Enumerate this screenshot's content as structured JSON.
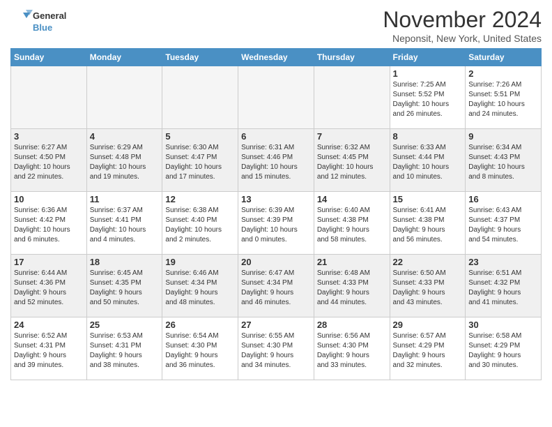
{
  "logo": {
    "line1": "General",
    "line2": "Blue"
  },
  "title": "November 2024",
  "location": "Neponsit, New York, United States",
  "days_of_week": [
    "Sunday",
    "Monday",
    "Tuesday",
    "Wednesday",
    "Thursday",
    "Friday",
    "Saturday"
  ],
  "weeks": [
    [
      {
        "day": "",
        "info": ""
      },
      {
        "day": "",
        "info": ""
      },
      {
        "day": "",
        "info": ""
      },
      {
        "day": "",
        "info": ""
      },
      {
        "day": "",
        "info": ""
      },
      {
        "day": "1",
        "info": "Sunrise: 7:25 AM\nSunset: 5:52 PM\nDaylight: 10 hours\nand 26 minutes."
      },
      {
        "day": "2",
        "info": "Sunrise: 7:26 AM\nSunset: 5:51 PM\nDaylight: 10 hours\nand 24 minutes."
      }
    ],
    [
      {
        "day": "3",
        "info": "Sunrise: 6:27 AM\nSunset: 4:50 PM\nDaylight: 10 hours\nand 22 minutes."
      },
      {
        "day": "4",
        "info": "Sunrise: 6:29 AM\nSunset: 4:48 PM\nDaylight: 10 hours\nand 19 minutes."
      },
      {
        "day": "5",
        "info": "Sunrise: 6:30 AM\nSunset: 4:47 PM\nDaylight: 10 hours\nand 17 minutes."
      },
      {
        "day": "6",
        "info": "Sunrise: 6:31 AM\nSunset: 4:46 PM\nDaylight: 10 hours\nand 15 minutes."
      },
      {
        "day": "7",
        "info": "Sunrise: 6:32 AM\nSunset: 4:45 PM\nDaylight: 10 hours\nand 12 minutes."
      },
      {
        "day": "8",
        "info": "Sunrise: 6:33 AM\nSunset: 4:44 PM\nDaylight: 10 hours\nand 10 minutes."
      },
      {
        "day": "9",
        "info": "Sunrise: 6:34 AM\nSunset: 4:43 PM\nDaylight: 10 hours\nand 8 minutes."
      }
    ],
    [
      {
        "day": "10",
        "info": "Sunrise: 6:36 AM\nSunset: 4:42 PM\nDaylight: 10 hours\nand 6 minutes."
      },
      {
        "day": "11",
        "info": "Sunrise: 6:37 AM\nSunset: 4:41 PM\nDaylight: 10 hours\nand 4 minutes."
      },
      {
        "day": "12",
        "info": "Sunrise: 6:38 AM\nSunset: 4:40 PM\nDaylight: 10 hours\nand 2 minutes."
      },
      {
        "day": "13",
        "info": "Sunrise: 6:39 AM\nSunset: 4:39 PM\nDaylight: 10 hours\nand 0 minutes."
      },
      {
        "day": "14",
        "info": "Sunrise: 6:40 AM\nSunset: 4:38 PM\nDaylight: 9 hours\nand 58 minutes."
      },
      {
        "day": "15",
        "info": "Sunrise: 6:41 AM\nSunset: 4:38 PM\nDaylight: 9 hours\nand 56 minutes."
      },
      {
        "day": "16",
        "info": "Sunrise: 6:43 AM\nSunset: 4:37 PM\nDaylight: 9 hours\nand 54 minutes."
      }
    ],
    [
      {
        "day": "17",
        "info": "Sunrise: 6:44 AM\nSunset: 4:36 PM\nDaylight: 9 hours\nand 52 minutes."
      },
      {
        "day": "18",
        "info": "Sunrise: 6:45 AM\nSunset: 4:35 PM\nDaylight: 9 hours\nand 50 minutes."
      },
      {
        "day": "19",
        "info": "Sunrise: 6:46 AM\nSunset: 4:34 PM\nDaylight: 9 hours\nand 48 minutes."
      },
      {
        "day": "20",
        "info": "Sunrise: 6:47 AM\nSunset: 4:34 PM\nDaylight: 9 hours\nand 46 minutes."
      },
      {
        "day": "21",
        "info": "Sunrise: 6:48 AM\nSunset: 4:33 PM\nDaylight: 9 hours\nand 44 minutes."
      },
      {
        "day": "22",
        "info": "Sunrise: 6:50 AM\nSunset: 4:33 PM\nDaylight: 9 hours\nand 43 minutes."
      },
      {
        "day": "23",
        "info": "Sunrise: 6:51 AM\nSunset: 4:32 PM\nDaylight: 9 hours\nand 41 minutes."
      }
    ],
    [
      {
        "day": "24",
        "info": "Sunrise: 6:52 AM\nSunset: 4:31 PM\nDaylight: 9 hours\nand 39 minutes."
      },
      {
        "day": "25",
        "info": "Sunrise: 6:53 AM\nSunset: 4:31 PM\nDaylight: 9 hours\nand 38 minutes."
      },
      {
        "day": "26",
        "info": "Sunrise: 6:54 AM\nSunset: 4:30 PM\nDaylight: 9 hours\nand 36 minutes."
      },
      {
        "day": "27",
        "info": "Sunrise: 6:55 AM\nSunset: 4:30 PM\nDaylight: 9 hours\nand 34 minutes."
      },
      {
        "day": "28",
        "info": "Sunrise: 6:56 AM\nSunset: 4:30 PM\nDaylight: 9 hours\nand 33 minutes."
      },
      {
        "day": "29",
        "info": "Sunrise: 6:57 AM\nSunset: 4:29 PM\nDaylight: 9 hours\nand 32 minutes."
      },
      {
        "day": "30",
        "info": "Sunrise: 6:58 AM\nSunset: 4:29 PM\nDaylight: 9 hours\nand 30 minutes."
      }
    ]
  ]
}
